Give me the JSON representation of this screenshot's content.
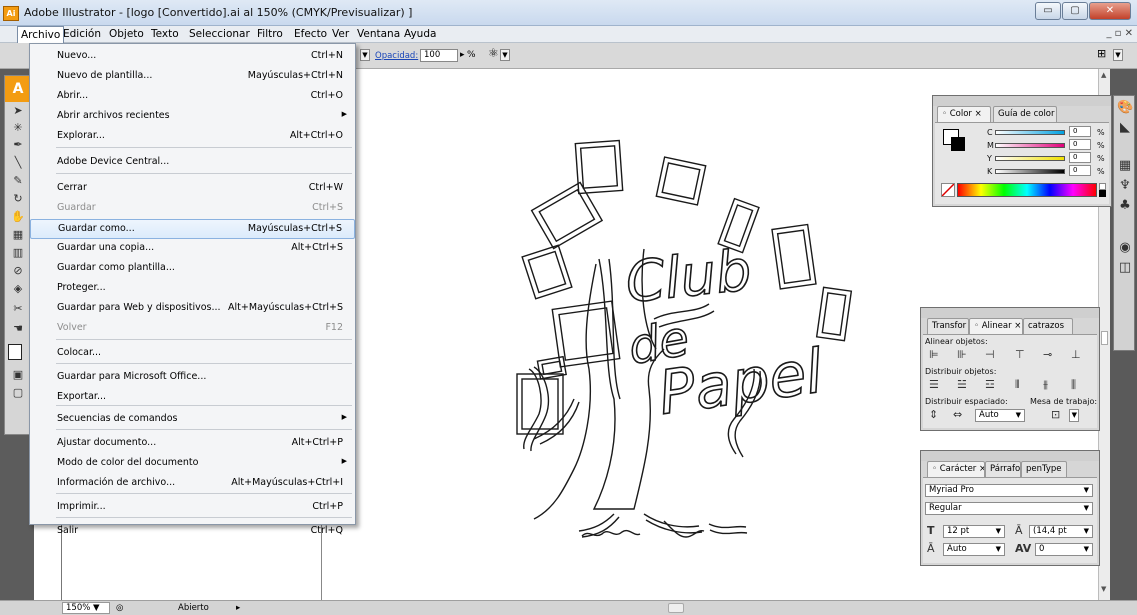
{
  "window": {
    "app_icon": "Ai",
    "title": "Adobe Illustrator - [logo [Convertido].ai al 150% (CMYK/Previsualizar) ]",
    "buttons": {
      "minimize": "▭",
      "maximize": "▢",
      "close": "✕"
    }
  },
  "menubar": {
    "items": [
      "Archivo",
      "Edición",
      "Objeto",
      "Texto",
      "Seleccionar",
      "Filtro",
      "Efecto",
      "Ver",
      "Ventana",
      "Ayuda"
    ],
    "right_controls": "_ ▫ ✕"
  },
  "controlbar": {
    "opacity_label": "Opacidad:",
    "opacity_value": "100",
    "percent": "%"
  },
  "file_menu": {
    "items": [
      {
        "label": "Nuevo...",
        "shortcut": "Ctrl+N"
      },
      {
        "label": "Nuevo de plantilla...",
        "shortcut": "Mayúsculas+Ctrl+N"
      },
      {
        "label": "Abrir...",
        "shortcut": "Ctrl+O"
      },
      {
        "label": "Abrir archivos recientes",
        "shortcut": "",
        "submenu": true
      },
      {
        "label": "Explorar...",
        "shortcut": "Alt+Ctrl+O"
      },
      {
        "label": "Adobe Device Central...",
        "shortcut": ""
      },
      {
        "label": "Cerrar",
        "shortcut": "Ctrl+W"
      },
      {
        "label": "Guardar",
        "shortcut": "Ctrl+S",
        "disabled": true
      },
      {
        "label": "Guardar como...",
        "shortcut": "Mayúsculas+Ctrl+S",
        "highlighted": true
      },
      {
        "label": "Guardar una copia...",
        "shortcut": "Alt+Ctrl+S"
      },
      {
        "label": "Guardar como plantilla...",
        "shortcut": ""
      },
      {
        "label": "Proteger...",
        "shortcut": ""
      },
      {
        "label": "Guardar para Web y dispositivos...",
        "shortcut": "Alt+Mayúsculas+Ctrl+S"
      },
      {
        "label": "Volver",
        "shortcut": "F12",
        "disabled": true
      },
      {
        "label": "Colocar...",
        "shortcut": ""
      },
      {
        "label": "Guardar para Microsoft Office...",
        "shortcut": ""
      },
      {
        "label": "Exportar...",
        "shortcut": ""
      },
      {
        "label": "Secuencias de comandos",
        "shortcut": "",
        "submenu": true
      },
      {
        "label": "Ajustar documento...",
        "shortcut": "Alt+Ctrl+P"
      },
      {
        "label": "Modo de color del documento",
        "shortcut": "",
        "submenu": true
      },
      {
        "label": "Información de archivo...",
        "shortcut": "Alt+Mayúsculas+Ctrl+I"
      },
      {
        "label": "Imprimir...",
        "shortcut": "Ctrl+P"
      },
      {
        "label": "Salir",
        "shortcut": "Ctrl+Q"
      }
    ]
  },
  "color_panel": {
    "tabs": [
      "Color",
      "Guía de color"
    ],
    "channels": [
      {
        "name": "C",
        "value": "0",
        "unit": "%",
        "color": "#00a0e0"
      },
      {
        "name": "M",
        "value": "0",
        "unit": "%",
        "color": "#e0007a"
      },
      {
        "name": "Y",
        "value": "0",
        "unit": "%",
        "color": "#f0e000"
      },
      {
        "name": "K",
        "value": "0",
        "unit": "%",
        "color": "#000000"
      }
    ]
  },
  "align_panel": {
    "tabs": [
      "Transfor",
      "Alinear",
      "catrazos"
    ],
    "align_objects": "Alinear objetos:",
    "distribute_objects": "Distribuir objetos:",
    "distribute_spacing": "Distribuir espaciado:",
    "align_to": "Mesa de trabajo:",
    "spacing_value": "Auto"
  },
  "character_panel": {
    "tabs": [
      "Carácter",
      "Párrafo",
      "penType"
    ],
    "font_family": "Myriad Pro",
    "font_style": "Regular",
    "font_size": "12 pt",
    "leading": "(14,4 pt",
    "kerning": "Auto",
    "tracking": "0"
  },
  "artwork": {
    "line1": "Club",
    "line2": "de",
    "line3": "Papel"
  },
  "statusbar": {
    "zoom": "150%",
    "status": "Abierto"
  }
}
